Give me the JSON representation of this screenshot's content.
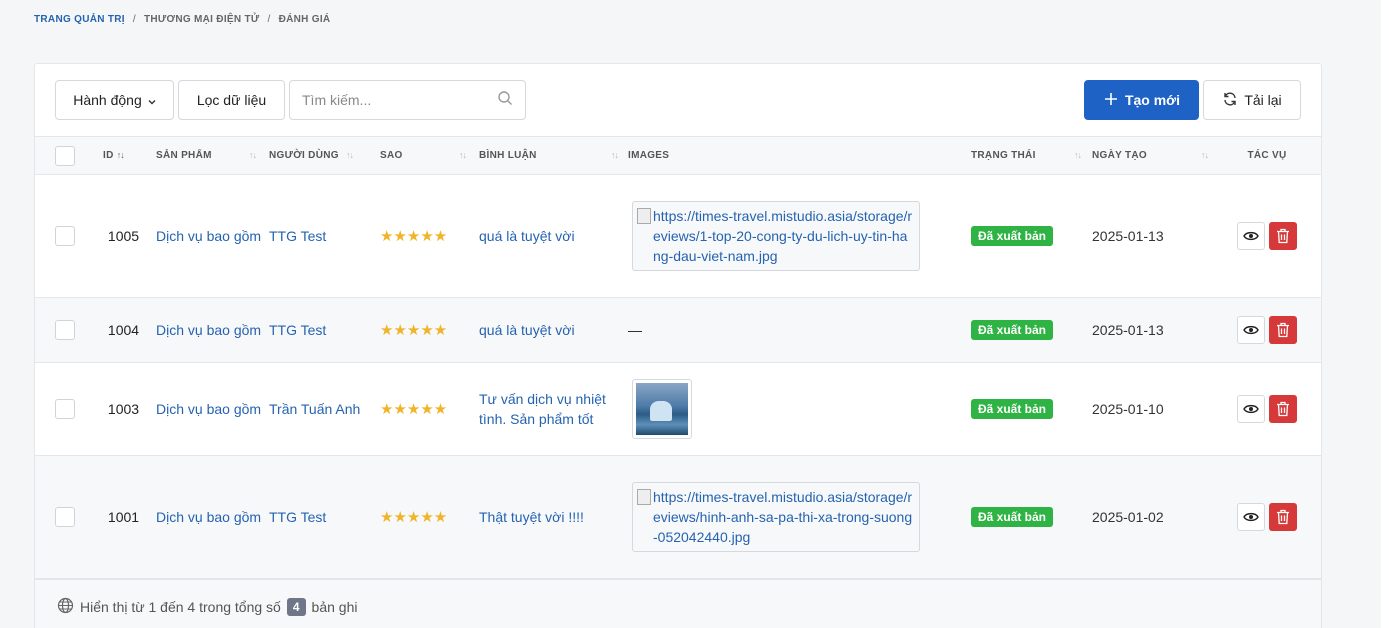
{
  "breadcrumb": {
    "root": "TRANG QUẢN TRỊ",
    "section": "THƯƠNG MẠI ĐIỆN TỬ",
    "page": "ĐÁNH GIÁ",
    "sep": "/"
  },
  "toolbar": {
    "action_label": "Hành động",
    "filter_label": "Lọc dữ liệu",
    "search_placeholder": "Tìm kiếm...",
    "create_label": "Tạo mới",
    "reload_label": "Tải lại"
  },
  "table": {
    "headers": {
      "id": "ID",
      "product": "SẢN PHẨM",
      "user": "NGƯỜI DÙNG",
      "stars": "SAO",
      "comment": "BÌNH LUẬN",
      "images": "IMAGES",
      "status": "TRẠNG THÁI",
      "created": "NGÀY TẠO",
      "actions": "TÁC VỤ"
    },
    "sort_id": "↑↓",
    "sort": "↑↓",
    "rows": [
      {
        "id": "1005",
        "product": "Dịch vụ bao gồm",
        "user": "TTG Test",
        "stars": "★★★★★",
        "comment": "quá là tuyệt vời",
        "image_text": "https://times-travel.mistudio.asia/storage/reviews/1-top-20-cong-ty-du-lich-uy-tin-hang-dau-viet-nam.jpg",
        "status": "Đã xuất bản",
        "created": "2025-01-13"
      },
      {
        "id": "1004",
        "product": "Dịch vụ bao gồm",
        "user": "TTG Test",
        "stars": "★★★★★",
        "comment": "quá là tuyệt vời",
        "image_text": "—",
        "status": "Đã xuất bản",
        "created": "2025-01-13"
      },
      {
        "id": "1003",
        "product": "Dịch vụ bao gồm",
        "user": "Trần Tuấn Anh",
        "stars": "★★★★★",
        "comment": "Tư vấn dịch vụ nhiệt tình. Sản phẩm tốt",
        "image_text": "",
        "status": "Đã xuất bản",
        "created": "2025-01-10"
      },
      {
        "id": "1001",
        "product": "Dịch vụ bao gồm",
        "user": "TTG Test",
        "stars": "★★★★★",
        "comment": "Thật tuyệt vời !!!!",
        "image_text": "https://times-travel.mistudio.asia/storage/reviews/hinh-anh-sa-pa-thi-xa-trong-suong-052042440.jpg",
        "status": "Đã xuất bản",
        "created": "2025-01-02"
      }
    ]
  },
  "footer": {
    "prefix": "Hiển thị từ 1 đến 4 trong tổng số",
    "total": "4",
    "suffix": "bản ghi"
  },
  "colors": {
    "primary": "#1f62c6",
    "success": "#2fb344",
    "danger": "#d63939",
    "star": "#f0b429"
  }
}
